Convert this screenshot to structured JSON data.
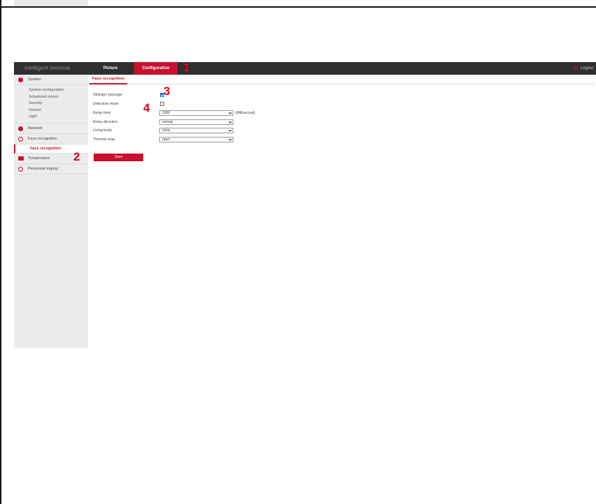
{
  "header": {
    "brand": "Intelligent terminal",
    "tabs": [
      {
        "label": "Picture",
        "active": false
      },
      {
        "label": "Configuration",
        "active": true
      }
    ],
    "logout_label": "Logout"
  },
  "sidebar": {
    "groups": [
      {
        "label": "System",
        "icon": "gear-icon",
        "items": [
          "System configuration",
          "Scheduled reboot",
          "Security",
          "Volume",
          "Light"
        ]
      },
      {
        "label": "Network",
        "icon": "globe-icon"
      },
      {
        "label": "Face recognition",
        "icon": "face-icon",
        "items": [
          "Face recognition"
        ],
        "active_item": "Face recognition"
      },
      {
        "label": "Temperature",
        "icon": "monitor-icon"
      },
      {
        "label": "Personnel inquiry",
        "icon": "info-icon"
      }
    ]
  },
  "main": {
    "subtab": "Face recognition",
    "fields": {
      "stranger_passage": {
        "label": "Stranger passage",
        "checked": true
      },
      "detection_mask": {
        "label": "Detection mask",
        "checked": false
      },
      "relay_time": {
        "label": "Relay time:",
        "value": "1000",
        "unit": "(Millisecond)"
      },
      "relay_direction": {
        "label": "Relay direction:",
        "value": "normal"
      },
      "living_body": {
        "label": "Living body:",
        "value": "close"
      },
      "thermal_map": {
        "label": "Thermal map:",
        "value": "open"
      }
    },
    "save_label": "Save"
  },
  "annotations": [
    "1",
    "2",
    "3",
    "4"
  ],
  "colors": {
    "accent": "#c8102e",
    "topbar": "#2f2f2f",
    "sidebar": "#ececec",
    "annotation": "#e3001b"
  }
}
